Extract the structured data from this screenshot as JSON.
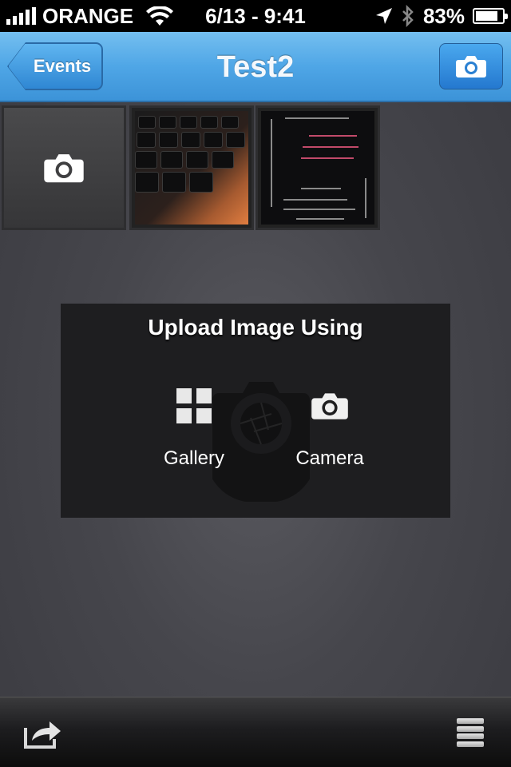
{
  "status_bar": {
    "carrier": "ORANGE",
    "time": "6/13 - 9:41",
    "battery_percent": "83%",
    "battery_level": 0.83,
    "icons": [
      "signal-icon",
      "wifi-icon",
      "location-arrow-icon",
      "bluetooth-icon",
      "battery-charging-icon"
    ]
  },
  "nav": {
    "back_label": "Events",
    "title": "Test2",
    "right_icon": "camera-icon"
  },
  "thumbnails": [
    {
      "kind": "add-photo",
      "icon": "camera-icon"
    },
    {
      "kind": "photo",
      "subject": "keyboard"
    },
    {
      "kind": "photo",
      "subject": "tips-screen"
    }
  ],
  "upload_dialog": {
    "title": "Upload Image Using",
    "options": [
      {
        "label": "Gallery",
        "icon": "grid-icon"
      },
      {
        "label": "Camera",
        "icon": "camera-icon"
      }
    ],
    "watermark_icon": "camera-pin-logo"
  },
  "toolbar": {
    "left_icon": "share-icon",
    "right_icon": "menu-icon"
  },
  "colors": {
    "nav_blue": "#4fa6e6",
    "background": "#46464c",
    "dialog": "#1e1e20"
  }
}
